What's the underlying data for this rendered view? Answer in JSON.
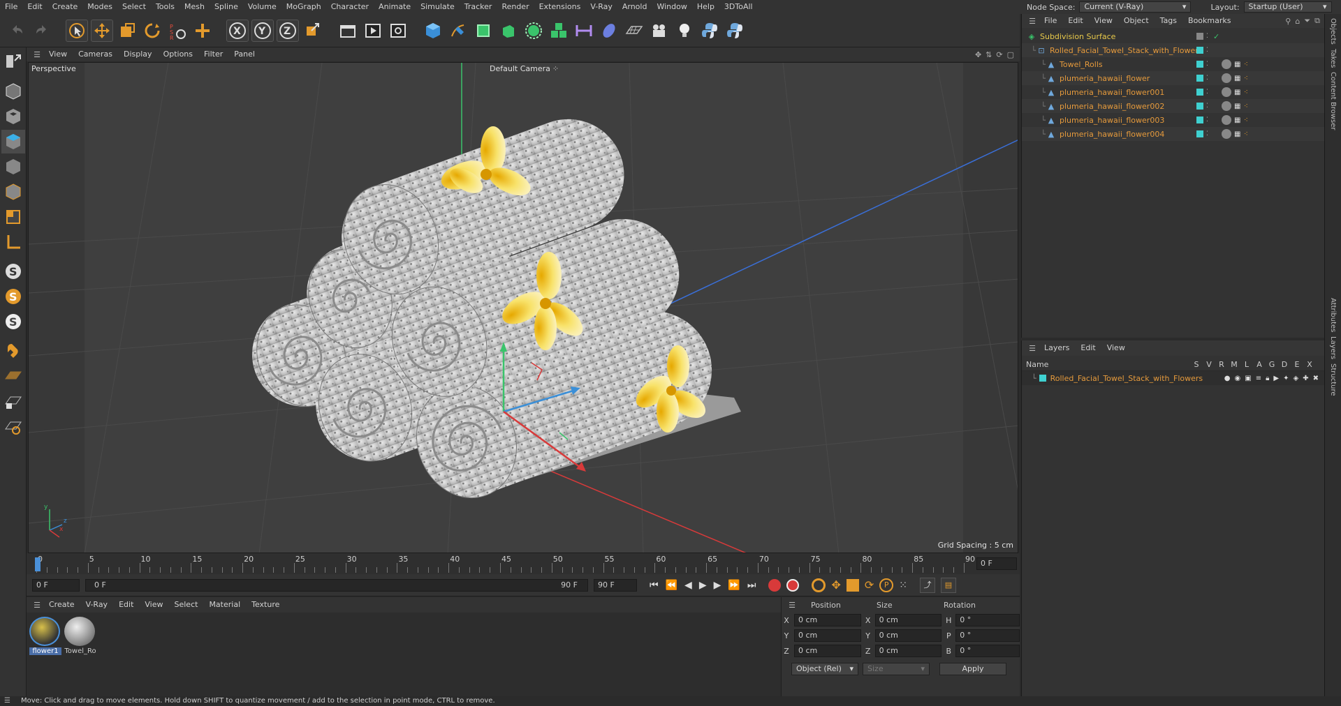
{
  "menubar": {
    "items": [
      "File",
      "Edit",
      "Create",
      "Modes",
      "Select",
      "Tools",
      "Mesh",
      "Spline",
      "Volume",
      "MoGraph",
      "Character",
      "Animate",
      "Simulate",
      "Tracker",
      "Render",
      "Extensions",
      "V-Ray",
      "Arnold",
      "Window",
      "Help",
      "3DToAll"
    ],
    "node_space_label": "Node Space:",
    "node_space_value": "Current (V-Ray)",
    "layout_label": "Layout:",
    "layout_value": "Startup (User)"
  },
  "viewport": {
    "menu": [
      "View",
      "Cameras",
      "Display",
      "Options",
      "Filter",
      "Panel"
    ],
    "view_name": "Perspective",
    "camera_label": "Default Camera",
    "grid_spacing": "Grid Spacing : 5 cm",
    "axis_y": "y",
    "axis_z": "z",
    "axis_x": "x"
  },
  "timeline": {
    "ticks": [
      "0",
      "5",
      "10",
      "15",
      "20",
      "25",
      "30",
      "35",
      "40",
      "45",
      "50",
      "55",
      "60",
      "65",
      "70",
      "75",
      "80",
      "85",
      "90"
    ],
    "end_field": "0 F"
  },
  "transport": {
    "start": "0 F",
    "range_start": "0 F",
    "range_end": "90 F",
    "end": "90 F"
  },
  "materials": {
    "menu": [
      "Create",
      "V-Ray",
      "Edit",
      "View",
      "Select",
      "Material",
      "Texture"
    ],
    "items": [
      {
        "label": "flower1"
      },
      {
        "label": "Towel_Ro"
      }
    ]
  },
  "coordinates": {
    "headers": [
      "Position",
      "Size",
      "Rotation"
    ],
    "rows": [
      {
        "axis": "X",
        "pos": "0 cm",
        "saxis": "X",
        "size": "0 cm",
        "raxis": "H",
        "rot": "0 °"
      },
      {
        "axis": "Y",
        "pos": "0 cm",
        "saxis": "Y",
        "size": "0 cm",
        "raxis": "P",
        "rot": "0 °"
      },
      {
        "axis": "Z",
        "pos": "0 cm",
        "saxis": "Z",
        "size": "0 cm",
        "raxis": "B",
        "rot": "0 °"
      }
    ],
    "mode": "Object (Rel)",
    "size_mode": "Size",
    "apply": "Apply"
  },
  "objects": {
    "menu": [
      "File",
      "Edit",
      "View",
      "Object",
      "Tags",
      "Bookmarks"
    ],
    "tree": [
      {
        "name": "Subdivision Surface",
        "level": 0,
        "color": "#e8c94a"
      },
      {
        "name": "Rolled_Facial_Towel_Stack_with_Flowers",
        "level": 1,
        "color": "#e59a3c"
      },
      {
        "name": "Towel_Rolls",
        "level": 2,
        "color": "#e59a3c"
      },
      {
        "name": "plumeria_hawaii_flower",
        "level": 2,
        "color": "#e59a3c"
      },
      {
        "name": "plumeria_hawaii_flower001",
        "level": 2,
        "color": "#e59a3c"
      },
      {
        "name": "plumeria_hawaii_flower002",
        "level": 2,
        "color": "#e59a3c"
      },
      {
        "name": "plumeria_hawaii_flower003",
        "level": 2,
        "color": "#e59a3c"
      },
      {
        "name": "plumeria_hawaii_flower004",
        "level": 2,
        "color": "#e59a3c"
      }
    ]
  },
  "layers": {
    "menu": [
      "Layers",
      "Edit",
      "View"
    ],
    "name_header": "Name",
    "flag_headers": [
      "S",
      "V",
      "R",
      "M",
      "L",
      "A",
      "G",
      "D",
      "E",
      "X"
    ],
    "items": [
      {
        "name": "Rolled_Facial_Towel_Stack_with_Flowers"
      }
    ]
  },
  "side_tabs": [
    "Objects",
    "Takes",
    "Content Browser",
    "Attributes",
    "Layers",
    "Structure"
  ],
  "status": "Move: Click and drag to move elements. Hold down SHIFT to quantize movement / add to the selection in point mode, CTRL to remove."
}
